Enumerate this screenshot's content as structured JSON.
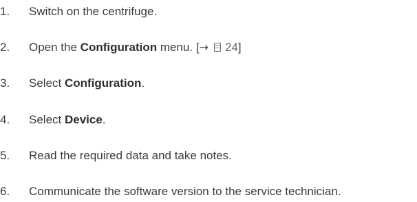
{
  "steps": [
    {
      "number": "1.",
      "text": "Switch on the centrifuge."
    },
    {
      "number": "2.",
      "before": "Open the ",
      "bold": "Configuration",
      "after": " menu.",
      "ref": {
        "open": "[",
        "arrow": "→",
        "icon": "page-reference-icon",
        "page": "24",
        "close": "]"
      }
    },
    {
      "number": "3.",
      "before": "Select ",
      "bold": "Configuration",
      "after": "."
    },
    {
      "number": "4.",
      "before": "Select ",
      "bold": "Device",
      "after": "."
    },
    {
      "number": "5.",
      "text": "Read the required data and take notes."
    },
    {
      "number": "6.",
      "text": "Communicate the software version to the service technician."
    }
  ]
}
